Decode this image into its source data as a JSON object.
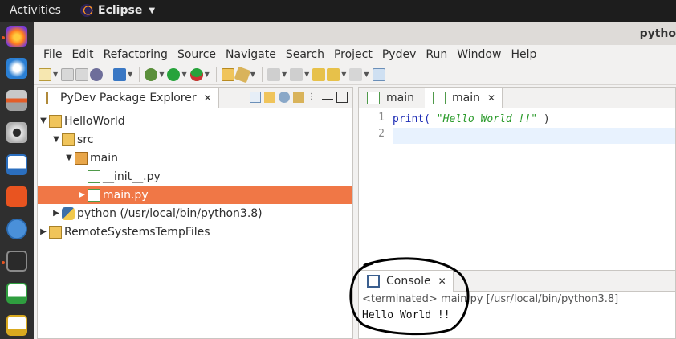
{
  "topbar": {
    "activities": "Activities",
    "app_name": "Eclipse"
  },
  "window": {
    "title": "pytho"
  },
  "menubar": {
    "items": [
      "File",
      "Edit",
      "Refactoring",
      "Source",
      "Navigate",
      "Search",
      "Project",
      "Pydev",
      "Run",
      "Window",
      "Help"
    ]
  },
  "explorer": {
    "title": "PyDev Package Explorer",
    "tree": [
      {
        "label": "HelloWorld"
      },
      {
        "label": "src"
      },
      {
        "label": "main"
      },
      {
        "label": "__init__.py"
      },
      {
        "label": "main.py"
      },
      {
        "label": "python  (/usr/local/bin/python3.8)"
      },
      {
        "label": "RemoteSystemsTempFiles"
      }
    ]
  },
  "editor": {
    "tabs": [
      "main",
      "main"
    ],
    "lines": [
      {
        "number": "1",
        "fn": "print(",
        "arg": "\"Hello World !!\"",
        "close": ")"
      },
      {
        "number": "2"
      }
    ]
  },
  "console": {
    "title": "Console",
    "status": "<terminated> main.py [/usr/local/bin/python3.8]",
    "output": "Hello World !!"
  },
  "colors": {
    "selection": "#f07746",
    "accent": "#e95420",
    "annotation": "#000000"
  }
}
